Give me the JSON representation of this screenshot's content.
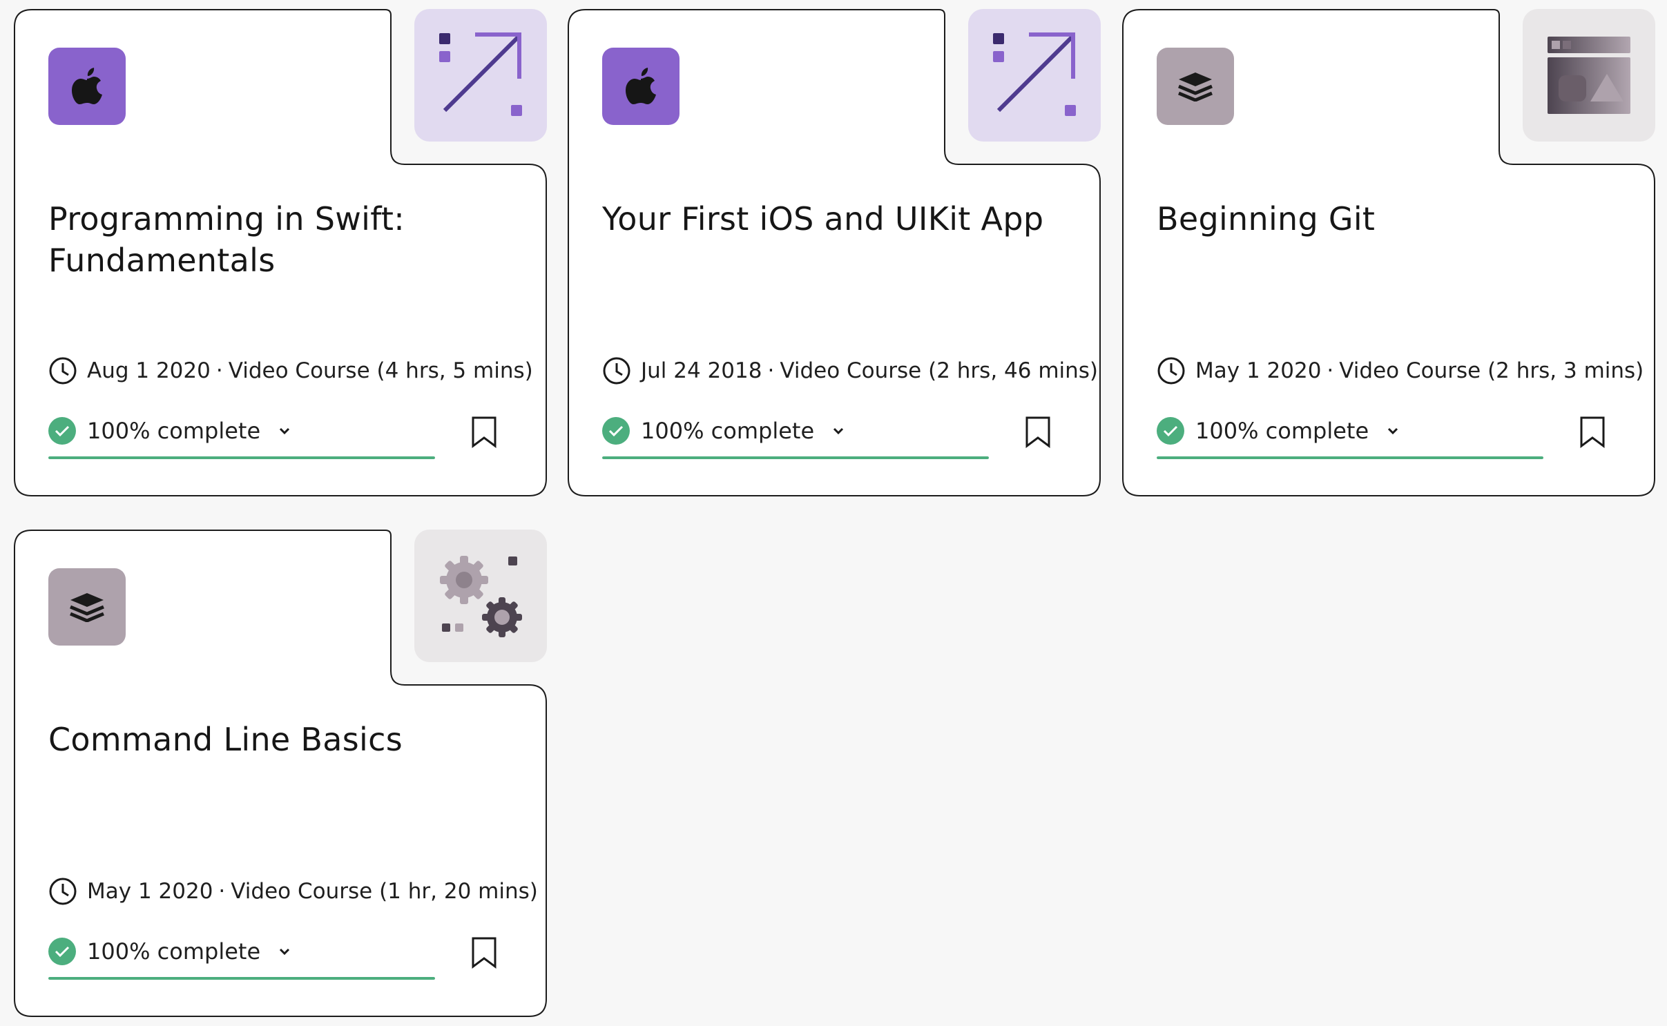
{
  "colors": {
    "ios_purple": "#8963cc",
    "ios_thumb_bg": "#e1daf0",
    "dev_grey": "#aea2ac",
    "dev_thumb_bg": "#e9e7e8",
    "progress_green": "#4cae7e"
  },
  "courses": [
    {
      "title": "Programming in Swift: Fundamentals",
      "date": "Aug 1 2020",
      "separator": "·",
      "type": "Video Course (4 hrs, 5 mins)",
      "progress_label": "100% complete",
      "progress_fraction": 1.0,
      "badge_icon": "apple-icon",
      "badge_theme": "ios",
      "thumbnail_icon": "arrow-up-right-icon"
    },
    {
      "title": "Your First iOS and UIKit App",
      "date": "Jul 24 2018",
      "separator": "·",
      "type": "Video Course (2 hrs, 46 mins)",
      "progress_label": "100% complete",
      "progress_fraction": 1.0,
      "badge_icon": "apple-icon",
      "badge_theme": "ios",
      "thumbnail_icon": "arrow-up-right-icon"
    },
    {
      "title": "Beginning Git",
      "date": "May 1 2020",
      "separator": "·",
      "type": "Video Course (2 hrs, 3 mins)",
      "progress_label": "100% complete",
      "progress_fraction": 1.0,
      "badge_icon": "layers-icon",
      "badge_theme": "dev",
      "thumbnail_icon": "browser-window-icon"
    },
    {
      "title": "Command Line Basics",
      "date": "May 1 2020",
      "separator": "·",
      "type": "Video Course (1 hr, 20 mins)",
      "progress_label": "100% complete",
      "progress_fraction": 1.0,
      "badge_icon": "layers-icon",
      "badge_theme": "dev",
      "thumbnail_icon": "gears-icon"
    }
  ]
}
